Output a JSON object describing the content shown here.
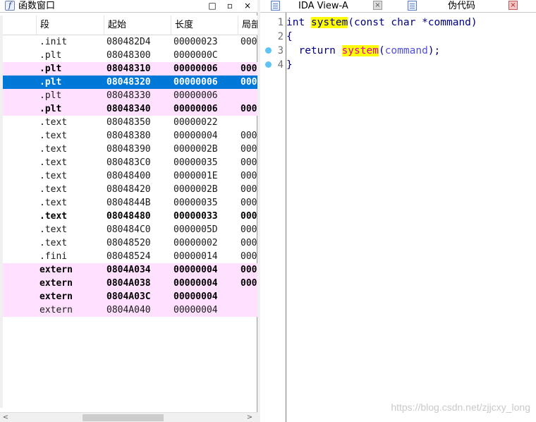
{
  "functions_window": {
    "title": "函数窗口",
    "icon": "f",
    "title_buttons": [
      "□",
      "▫",
      "×"
    ],
    "columns": [
      "段",
      "起始",
      "长度",
      "局部"
    ],
    "rows": [
      {
        "segment": ".init",
        "start": "080482D4",
        "length": "00000023",
        "locals": "000",
        "style": "normal"
      },
      {
        "segment": ".plt",
        "start": "08048300",
        "length": "0000000C",
        "locals": "",
        "style": "normal"
      },
      {
        "segment": ".plt",
        "start": "08048310",
        "length": "00000006",
        "locals": "000",
        "style": "pink-bold"
      },
      {
        "segment": ".plt",
        "start": "08048320",
        "length": "00000006",
        "locals": "000",
        "style": "selected"
      },
      {
        "segment": ".plt",
        "start": "08048330",
        "length": "00000006",
        "locals": "",
        "style": "pink"
      },
      {
        "segment": ".plt",
        "start": "08048340",
        "length": "00000006",
        "locals": "000",
        "style": "pink-bold"
      },
      {
        "segment": ".text",
        "start": "08048350",
        "length": "00000022",
        "locals": "",
        "style": "normal"
      },
      {
        "segment": ".text",
        "start": "08048380",
        "length": "00000004",
        "locals": "000",
        "style": "normal"
      },
      {
        "segment": ".text",
        "start": "08048390",
        "length": "0000002B",
        "locals": "000",
        "style": "normal"
      },
      {
        "segment": ".text",
        "start": "080483C0",
        "length": "00000035",
        "locals": "000",
        "style": "normal"
      },
      {
        "segment": ".text",
        "start": "08048400",
        "length": "0000001E",
        "locals": "000",
        "style": "normal"
      },
      {
        "segment": ".text",
        "start": "08048420",
        "length": "0000002B",
        "locals": "000",
        "style": "normal"
      },
      {
        "segment": ".text",
        "start": "0804844B",
        "length": "00000035",
        "locals": "000",
        "style": "normal"
      },
      {
        "segment": ".text",
        "start": "08048480",
        "length": "00000033",
        "locals": "000",
        "style": "bold"
      },
      {
        "segment": ".text",
        "start": "080484C0",
        "length": "0000005D",
        "locals": "000",
        "style": "normal"
      },
      {
        "segment": ".text",
        "start": "08048520",
        "length": "00000002",
        "locals": "000",
        "style": "normal"
      },
      {
        "segment": ".fini",
        "start": "08048524",
        "length": "00000014",
        "locals": "000",
        "style": "normal"
      },
      {
        "segment": "extern",
        "start": "0804A034",
        "length": "00000004",
        "locals": "000",
        "style": "pink-bold"
      },
      {
        "segment": "extern",
        "start": "0804A038",
        "length": "00000004",
        "locals": "000",
        "style": "pink-bold"
      },
      {
        "segment": "extern",
        "start": "0804A03C",
        "length": "00000004",
        "locals": "",
        "style": "pink-bold"
      },
      {
        "segment": "extern",
        "start": "0804A040",
        "length": "00000004",
        "locals": "",
        "style": "pink"
      }
    ],
    "scroll_arrows": [
      "<",
      ">"
    ]
  },
  "tabs": [
    {
      "label": "IDA View-A",
      "active": false,
      "close": "×"
    },
    {
      "label": "伪代码",
      "active": true,
      "close": "×"
    }
  ],
  "pseudocode": {
    "line_numbers": [
      "1",
      "2",
      "3",
      "4"
    ],
    "breakpoint_lines": [
      3,
      4
    ],
    "lines": [
      {
        "t1": "int ",
        "fn": "system",
        "t2": "(const char *command)"
      },
      {
        "t1": "{"
      },
      {
        "t1": "  return ",
        "fn": "system",
        "t2": "(",
        "arg": "command",
        "t3": ");"
      },
      {
        "t1": "}"
      }
    ]
  },
  "watermark": "https://blog.csdn.net/zjjcxy_long",
  "colors": {
    "selected_row": "#0078d7",
    "pink_row": "#ffe0ff",
    "highlight": "#ffff00",
    "breakpoint": "#5fc3f5"
  }
}
